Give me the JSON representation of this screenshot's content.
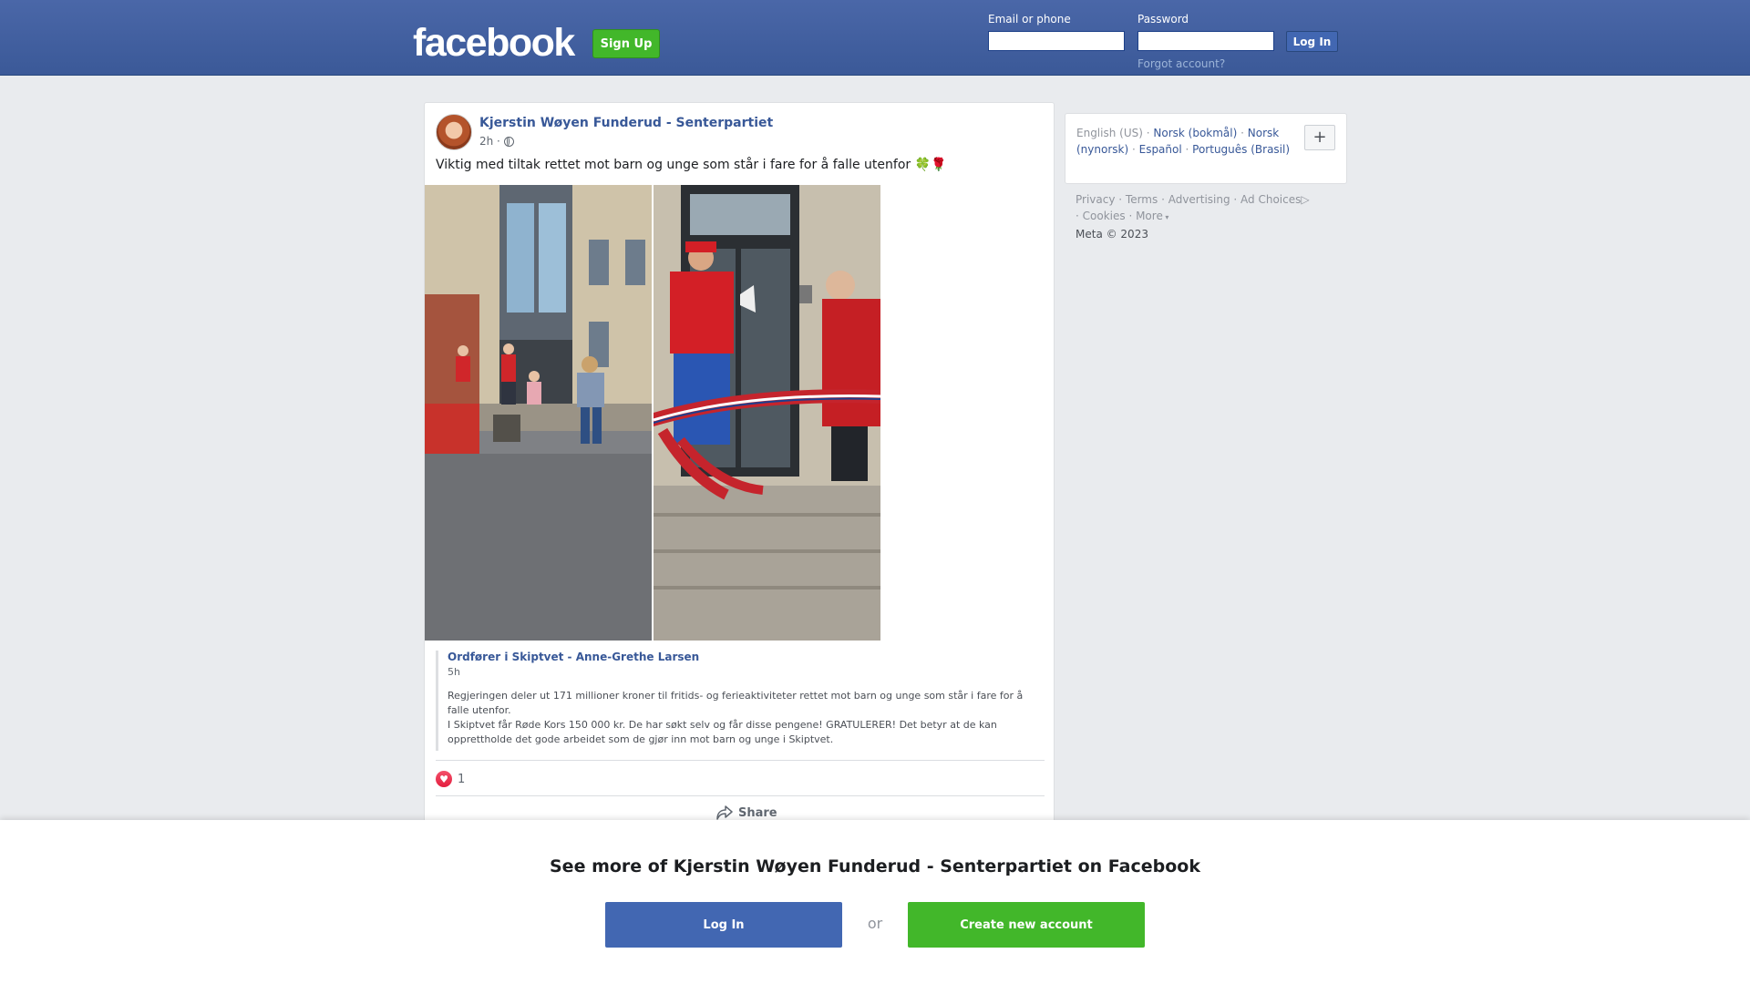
{
  "header": {
    "logo": "facebook",
    "signup_label": "Sign Up",
    "email_label": "Email or phone",
    "password_label": "Password",
    "login_label": "Log In",
    "forgot_label": "Forgot account?",
    "email_value": "",
    "password_value": ""
  },
  "post": {
    "author": "Kjerstin Wøyen Funderud - Senterpartiet",
    "time": "2h ·",
    "text": "Viktig med tiltak rettet mot barn og unge som står i fare for å falle utenfor 🍀🌹",
    "shared": {
      "author": "Ordfører i Skiptvet - Anne-Grethe Larsen",
      "time": "5h",
      "text_line1": "Regjeringen deler ut 171 millioner kroner til fritids- og ferieaktiviteter rettet mot barn og unge som står i fare for å falle utenfor.",
      "text_line2": "I Skiptvet får Røde Kors 150 000 kr. De har søkt selv og får disse pengene! GRATULERER! Det betyr at de kan opprettholde det gode arbeidet som de gjør inn mot barn og unge i Skiptvet."
    },
    "reaction_count": "1",
    "share_label": "Share"
  },
  "sidebar": {
    "lang_current": "English (US)",
    "lang_links": [
      "Norsk (bokmål)",
      "Norsk (nynorsk)",
      "Español",
      "Português (Brasil)"
    ],
    "plus_label": "+",
    "footer_links": [
      "Privacy",
      "Terms",
      "Advertising",
      "Ad Choices",
      "Cookies",
      "More"
    ],
    "copyright": "Meta © 2023"
  },
  "overlay": {
    "title": "See more of Kjerstin Wøyen Funderud - Senterpartiet on Facebook",
    "login_label": "Log In",
    "or_label": "or",
    "create_label": "Create new account"
  },
  "colors": {
    "brand_blue": "#3b5998",
    "link_blue": "#385898",
    "green": "#42b72a",
    "button_blue": "#4267b2",
    "heart_red": "#e41e3f"
  }
}
